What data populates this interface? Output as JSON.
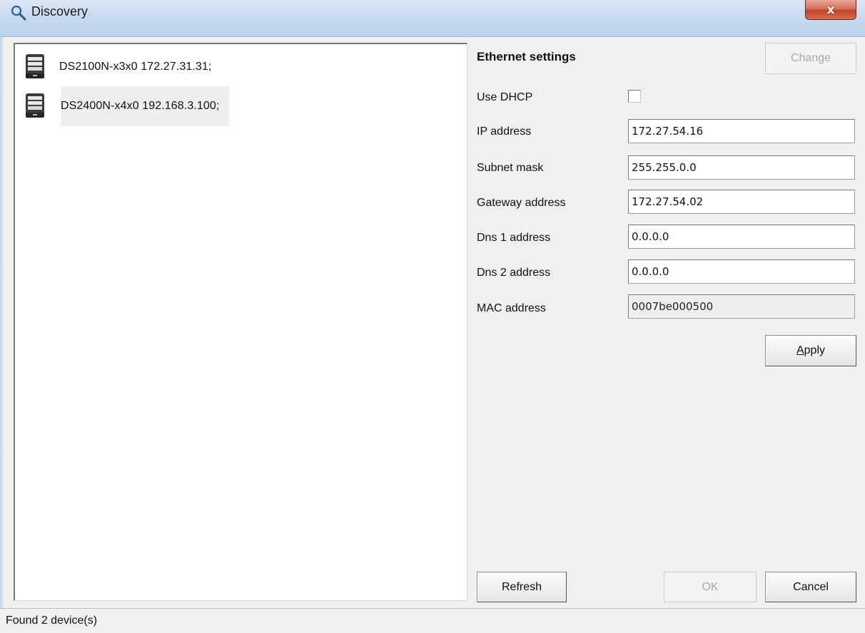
{
  "window": {
    "title": "Discovery",
    "close_label": "x"
  },
  "devices": [
    {
      "label": "DS2100N-x3x0 172.27.31.31;",
      "icon": "server-icon"
    },
    {
      "label": "DS2400N-x4x0 192.168.3.100;",
      "icon": "server-icon"
    }
  ],
  "settings": {
    "title": "Ethernet settings",
    "change_label": "Change",
    "use_dhcp_label": "Use DHCP",
    "use_dhcp_checked": false,
    "ip_label": "IP address",
    "ip_value": "172.27.54.16",
    "subnet_label": "Subnet mask",
    "subnet_value": "255.255.0.0",
    "gateway_label": "Gateway address",
    "gateway_value": "172.27.54.02",
    "dns1_label": "Dns 1 address",
    "dns1_value": "0.0.0.0",
    "dns2_label": "Dns 2 address",
    "dns2_value": "0.0.0.0",
    "mac_label": "MAC address",
    "mac_value": "0007be000500",
    "apply_first": "A",
    "apply_rest": "pply"
  },
  "buttons": {
    "refresh": "Refresh",
    "ok": "OK",
    "cancel": "Cancel"
  },
  "status": {
    "text": "Found 2 device(s)"
  }
}
